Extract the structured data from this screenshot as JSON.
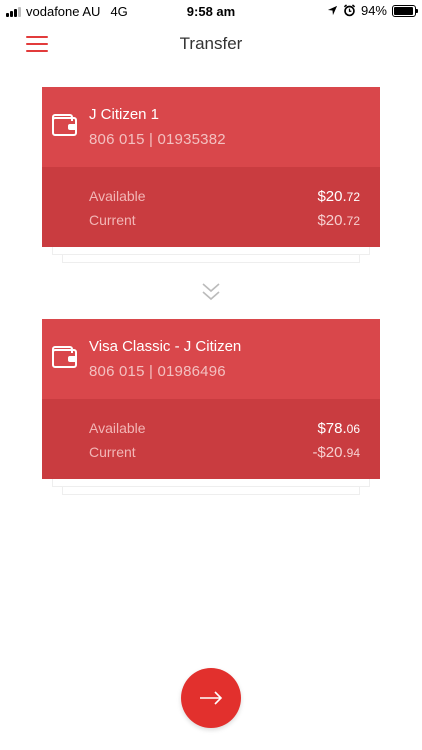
{
  "status_bar": {
    "carrier": "vodafone AU",
    "network": "4G",
    "time": "9:58 am",
    "battery": "94%"
  },
  "header": {
    "title": "Transfer"
  },
  "from_account": {
    "name": "J Citizen 1",
    "number": "806 015 | 01935382",
    "available_label": "Available",
    "available_main": "$20.",
    "available_cents": "72",
    "current_label": "Current",
    "current_main": "$20.",
    "current_cents": "72"
  },
  "to_account": {
    "name": "Visa Classic - J Citizen",
    "number": "806 015 | 01986496",
    "available_label": "Available",
    "available_main": "$78.",
    "available_cents": "06",
    "current_label": "Current",
    "current_main": "-$20.",
    "current_cents": "94"
  },
  "colors": {
    "accent": "#e23b3b",
    "card": "#d9474b",
    "card_dark": "#c93c40",
    "fab": "#e2302d"
  },
  "icons": {
    "menu": "hamburger-icon",
    "account": "wallet-icon",
    "direction": "double-chevron-down-icon",
    "next": "arrow-right-icon"
  }
}
